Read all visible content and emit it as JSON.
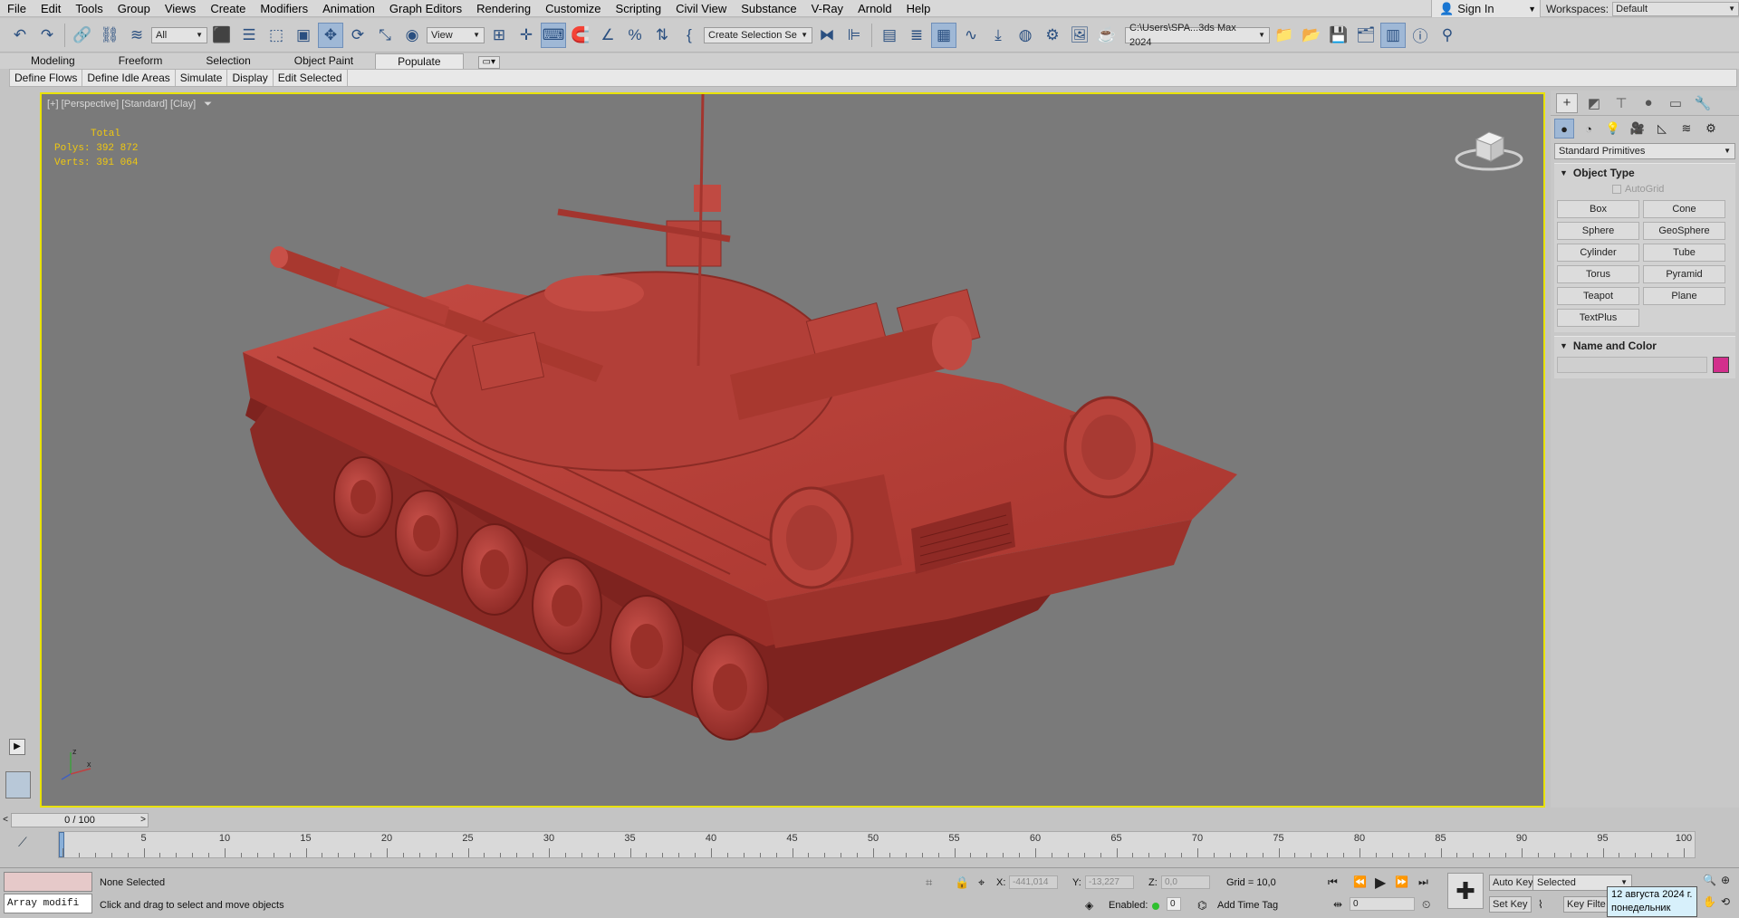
{
  "menu": {
    "items": [
      "File",
      "Edit",
      "Tools",
      "Group",
      "Views",
      "Create",
      "Modifiers",
      "Animation",
      "Graph Editors",
      "Rendering",
      "Customize",
      "Scripting",
      "Civil View",
      "Substance",
      "V-Ray",
      "Arnold",
      "Help"
    ],
    "sign_in": "Sign In",
    "workspaces_label": "Workspaces:",
    "workspace_value": "Default"
  },
  "toolbar": {
    "filter_value": "All",
    "ref_coord_value": "View",
    "selection_set_value": "Create Selection Se",
    "project_path": "C:\\Users\\SPA...3ds Max 2024"
  },
  "ribbon": {
    "tabs": [
      "Modeling",
      "Freeform",
      "Selection",
      "Object Paint",
      "Populate"
    ],
    "active_tab": "Populate",
    "sub_buttons": [
      "Define Flows",
      "Define Idle Areas",
      "Simulate",
      "Display",
      "Edit Selected"
    ]
  },
  "viewport": {
    "label": "[+] [Perspective] [Standard] [Clay]",
    "stats_title": "Total",
    "polys_label": "Polys:",
    "polys_value": "392 872",
    "verts_label": "Verts:",
    "verts_value": "391 064"
  },
  "command_panel": {
    "category_value": "Standard Primitives",
    "object_type_title": "Object Type",
    "autogrid_label": "AutoGrid",
    "object_buttons": [
      "Box",
      "Cone",
      "Sphere",
      "GeoSphere",
      "Cylinder",
      "Tube",
      "Torus",
      "Pyramid",
      "Teapot",
      "Plane",
      "TextPlus"
    ],
    "name_color_title": "Name and Color",
    "object_color": "#d22f8c"
  },
  "timeline": {
    "frame_display": "0 / 100",
    "ticks": [
      "5",
      "10",
      "15",
      "20",
      "25",
      "30",
      "35",
      "40",
      "45",
      "50",
      "55",
      "60",
      "65",
      "70",
      "75",
      "80",
      "85",
      "90",
      "95",
      "100"
    ]
  },
  "status": {
    "listener_text": "Array modifi",
    "selection_status": "None Selected",
    "prompt": "Click and drag to select and move objects",
    "x_label": "X:",
    "x_value": "-441,014",
    "y_label": "Y:",
    "y_value": "-13,227",
    "z_label": "Z:",
    "z_value": "0,0",
    "grid": "Grid = 10,0",
    "enabled_label": "Enabled:",
    "enabled_value": "0",
    "add_time_tag": "Add Time Tag",
    "auto_key": "Auto Key",
    "set_key": "Set Key",
    "key_mode_value": "Selected",
    "key_filters": "Key Filte",
    "frame_value": "0",
    "date_tooltip_line1": "12 августа 2024 г.",
    "date_tooltip_line2": "понедельник"
  },
  "colors": {
    "viewport_bg": "#7a7a7a",
    "active_border": "#e9e200",
    "model": "#b53a34",
    "stats": "#f0c810"
  }
}
